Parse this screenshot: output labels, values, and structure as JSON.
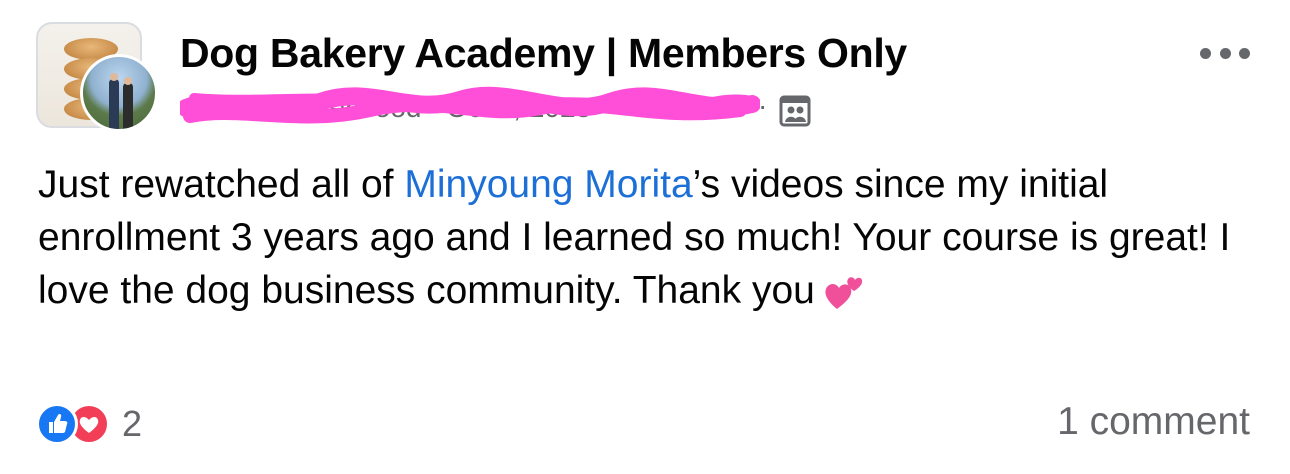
{
  "post": {
    "group_name": "Dog Bakery Academy | Members Only",
    "author_date_redacted": "Jennifer Sherwood · Oct 9, 2023",
    "meta_separator": "·",
    "text": {
      "part1": "Just rewatched all of ",
      "mention": "Minyoung Morita",
      "part2": "’s videos since my initial enrollment 3 years ago and I learned so much! Your course is great! I love the dog business community. Thank you",
      "emoji": "two-hearts-emoji"
    },
    "reactions": {
      "types": [
        "like",
        "love"
      ],
      "count": "2"
    },
    "comments": "1 comment"
  },
  "colors": {
    "text": "#050505",
    "secondary": "#65676b",
    "link": "#1b6fd6",
    "like": "#1877f2",
    "love": "#f33e58",
    "redaction": "#ff4fd8"
  },
  "icons": {
    "privacy": "group-members-icon",
    "more": "more-options-icon"
  }
}
